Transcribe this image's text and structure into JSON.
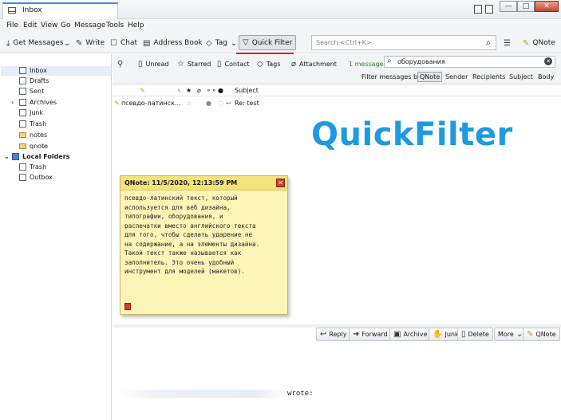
{
  "titlebar": {
    "tab_title": "Inbox",
    "window_buttons": [
      "—",
      "□",
      "✕"
    ]
  },
  "menubar": {
    "items": [
      "File",
      "Edit",
      "View",
      "Go",
      "Message",
      "Tools",
      "Help"
    ]
  },
  "toolbar": {
    "get_messages": "Get Messages",
    "write": "Write",
    "chat": "Chat",
    "address_book": "Address Book",
    "tag": "Tag",
    "quick_filter": "Quick Filter",
    "search_placeholder": "Search <Ctrl+K>",
    "qnote": "QNote"
  },
  "folders": {
    "items": [
      {
        "label": "Inbox"
      },
      {
        "label": "Drafts"
      },
      {
        "label": "Sent"
      },
      {
        "label": "Archives"
      },
      {
        "label": "Junk"
      },
      {
        "label": "Trash"
      },
      {
        "label": "notes"
      },
      {
        "label": "qnote"
      },
      {
        "label": "Local Folders"
      },
      {
        "label": "Trash"
      },
      {
        "label": "Outbox"
      }
    ]
  },
  "quickfilter": {
    "unread": "Unread",
    "starred": "Starred",
    "contact": "Contact",
    "tags": "Tags",
    "attachment": "Attachment",
    "count": "1 message",
    "search_value": "оборудования",
    "filter_by_label": "Filter messages by:",
    "filter_by": [
      "QNote",
      "Sender",
      "Recipients",
      "Subject",
      "Body"
    ]
  },
  "columns": {
    "subject": "Subject"
  },
  "message": {
    "sender": "псевдо-латинск...",
    "subject": "Re: test"
  },
  "watermark": "QuickFilter",
  "qnote_popup": {
    "title": "QNote: 11/5/2020, 12:13:59 PM",
    "body": "псевдо-латинский текст, который\nиспользуется для веб дизайна,\nтипографии, оборудования, и\nраспечатки вместо английского текста\nдля того, чтобы сделать ударение не\nна содержание, а на элементы дизайна.\nТакой текст также называется как\nзаполнитель. Это очень удобный\nинструмент для моделей (макетов)."
  },
  "header_actions": {
    "reply": "Reply",
    "forward": "Forward",
    "archive": "Archive",
    "junk": "Junk",
    "delete": "Delete",
    "more": "More",
    "qnote": "QNote"
  },
  "body": {
    "wrote": "wrote:"
  },
  "colors": {
    "accent_red": "#e0161e",
    "watermark_blue": "#1e9be0",
    "note_yellow": "#fdf5b7",
    "count_green": "#2b8a2b"
  }
}
